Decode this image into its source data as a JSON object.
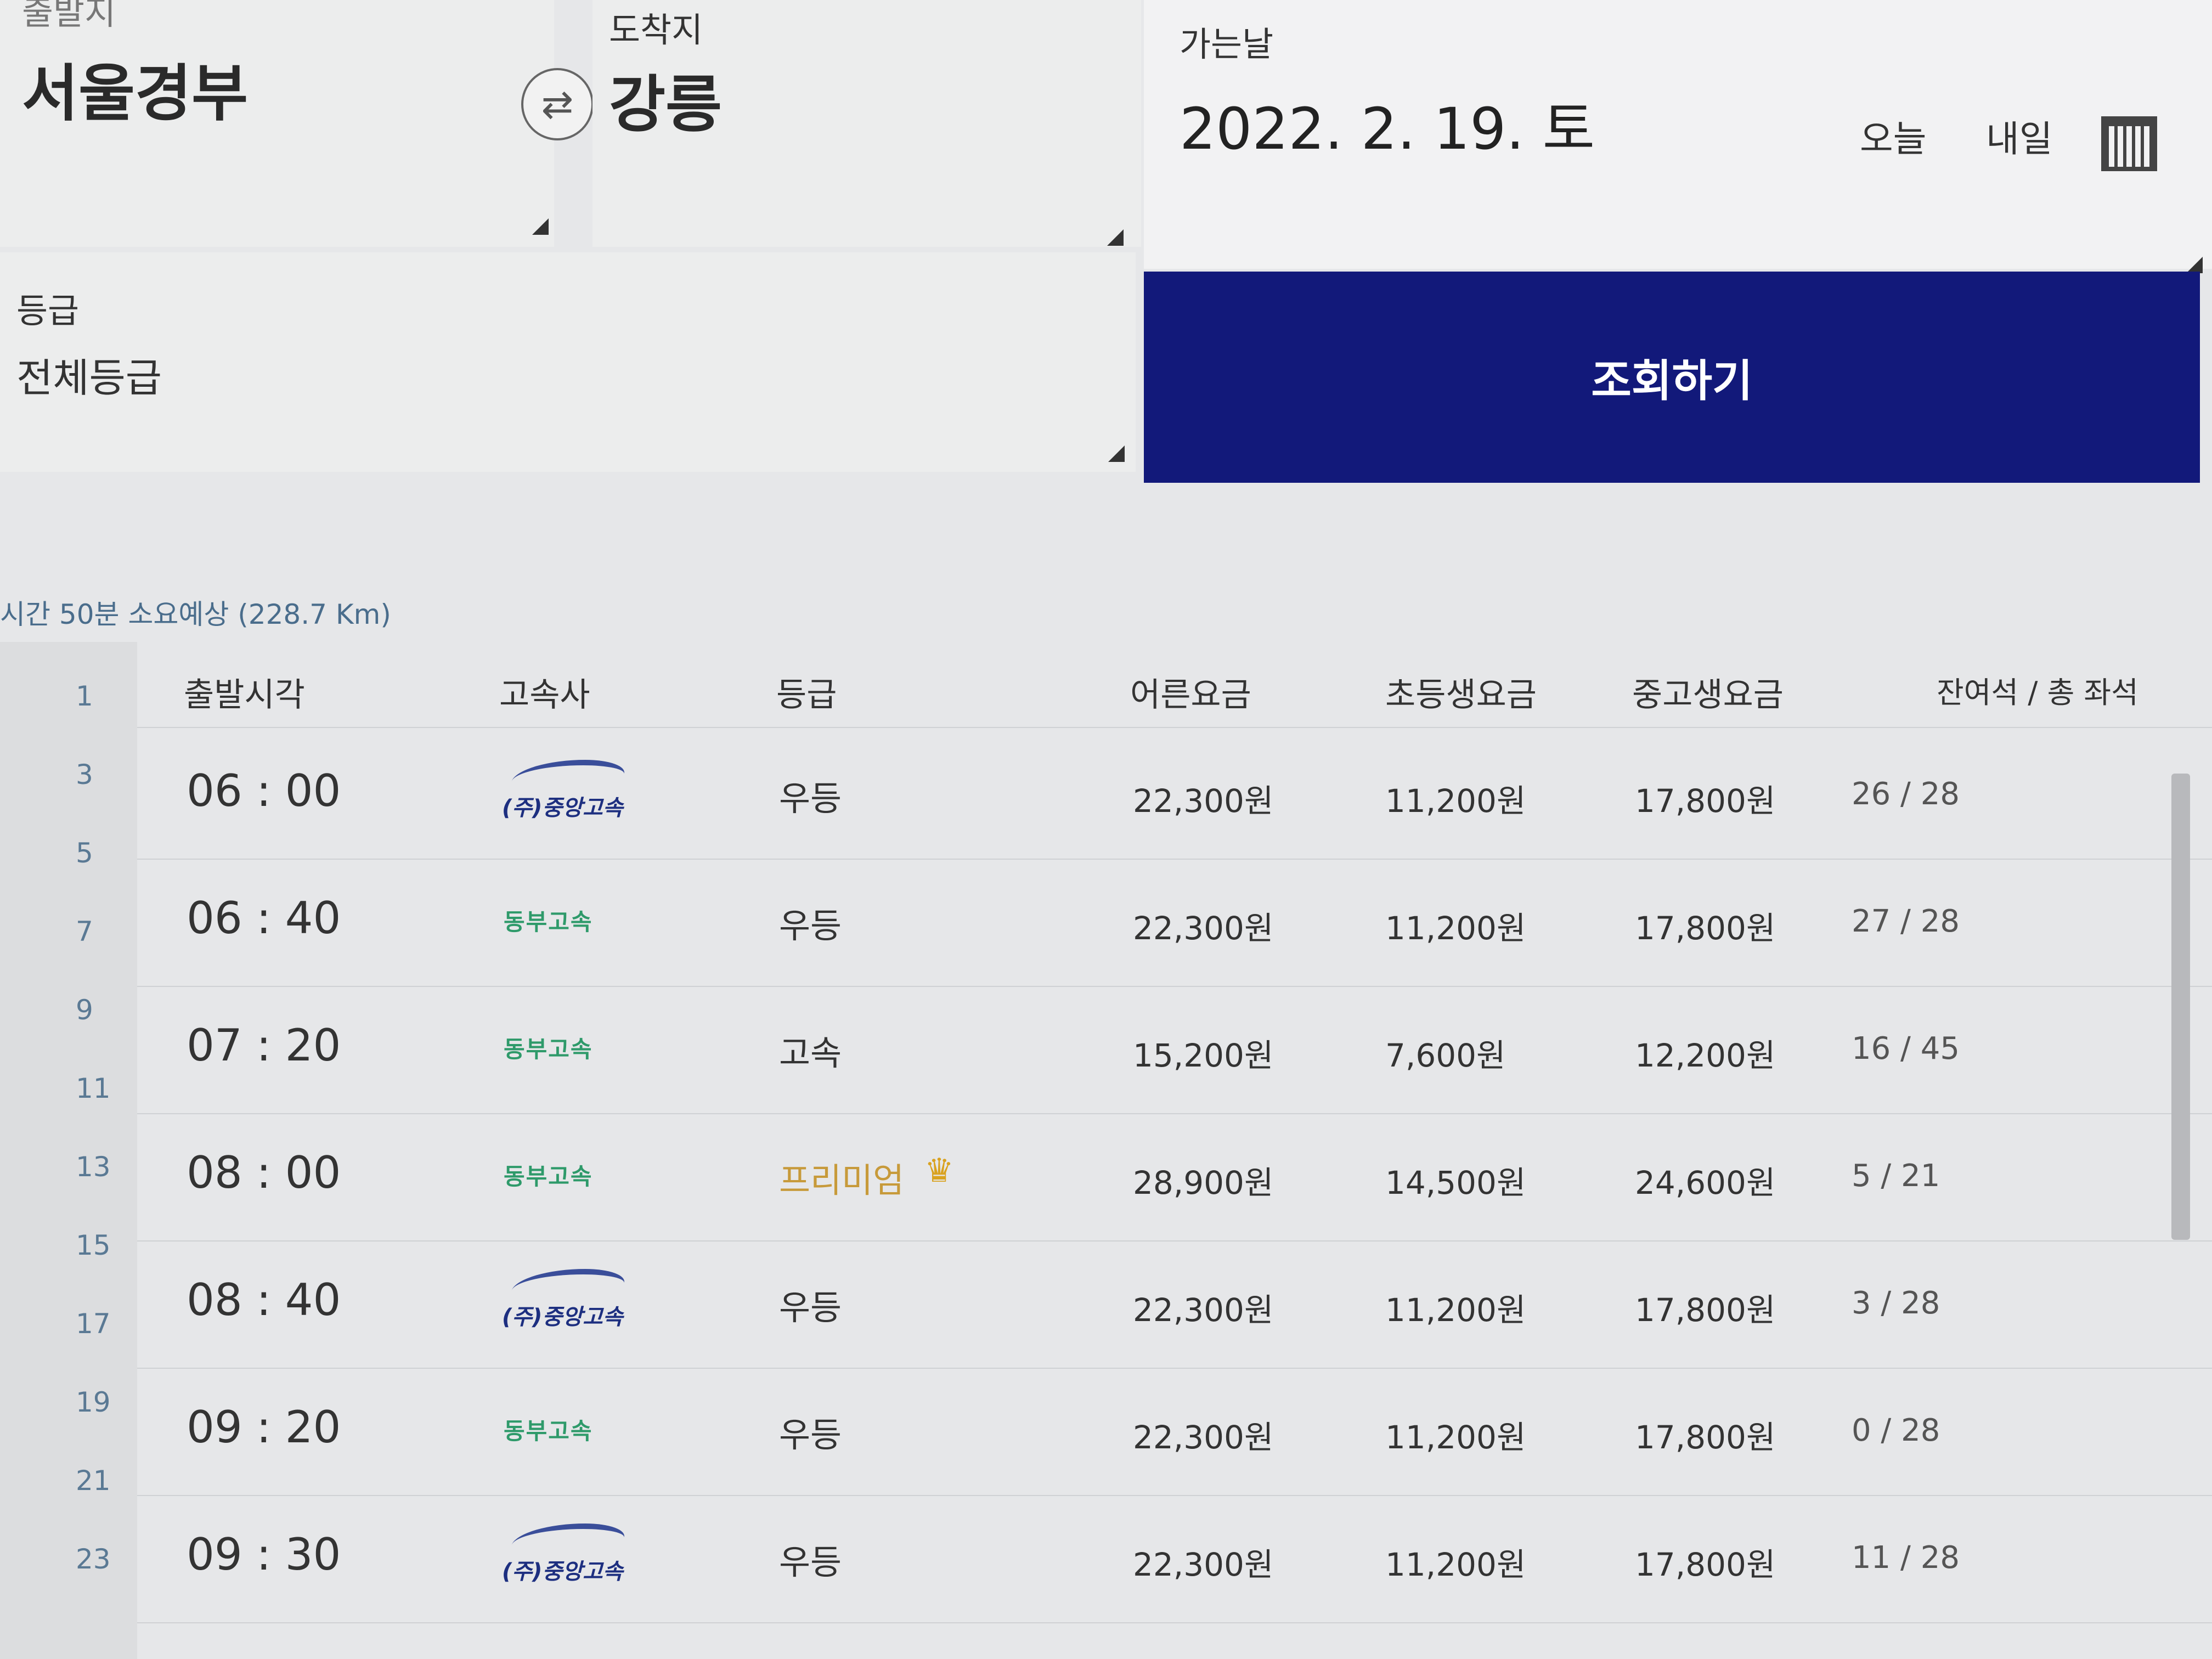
{
  "search": {
    "departure_label": "출발지",
    "departure_value": "서울경부",
    "arrival_label": "도착지",
    "arrival_value": "강릉",
    "date_label": "가는날",
    "date_value": "2022. 2. 19. 토",
    "today_label": "오늘",
    "tomorrow_label": "내일",
    "grade_label": "등급",
    "grade_value": "전체등급",
    "search_button": "조회하기"
  },
  "route_info": "시간 50분 소요예상 (228.7 Km)",
  "line_numbers": [
    "1",
    "3",
    "5",
    "7",
    "9",
    "11",
    "13",
    "15",
    "17",
    "19",
    "21",
    "23"
  ],
  "table": {
    "headers": [
      "출발시각",
      "고속사",
      "등급",
      "어른요금",
      "초등생요금",
      "중고생요금",
      "잔여석 / 총 좌석"
    ],
    "rows": [
      {
        "time": "06 : 00",
        "company": "(주)중앙고속",
        "company_logo": "jungang",
        "grade": "우등",
        "adult": "22,300원",
        "child": "11,200원",
        "student": "17,800원",
        "seats": "26 / 28"
      },
      {
        "time": "06 : 40",
        "company": "동부고속",
        "company_logo": "dongbu",
        "grade": "우등",
        "adult": "22,300원",
        "child": "11,200원",
        "student": "17,800원",
        "seats": "27 / 28"
      },
      {
        "time": "07 : 20",
        "company": "동부고속",
        "company_logo": "dongbu",
        "grade": "고속",
        "adult": "15,200원",
        "child": "7,600원",
        "student": "12,200원",
        "seats": "16 / 45"
      },
      {
        "time": "08 : 00",
        "company": "동부고속",
        "company_logo": "dongbu",
        "grade": "프리미엄",
        "premium": true,
        "adult": "28,900원",
        "child": "14,500원",
        "student": "24,600원",
        "seats": "5 / 21"
      },
      {
        "time": "08 : 40",
        "company": "(주)중앙고속",
        "company_logo": "jungang",
        "grade": "우등",
        "adult": "22,300원",
        "child": "11,200원",
        "student": "17,800원",
        "seats": "3 / 28"
      },
      {
        "time": "09 : 20",
        "company": "동부고속",
        "company_logo": "dongbu",
        "grade": "우등",
        "adult": "22,300원",
        "child": "11,200원",
        "student": "17,800원",
        "seats": "0 / 28"
      },
      {
        "time": "09 : 30",
        "company": "(주)중앙고속",
        "company_logo": "jungang",
        "grade": "우등",
        "adult": "22,300원",
        "child": "11,200원",
        "student": "17,800원",
        "seats": "11 / 28"
      }
    ]
  },
  "colors": {
    "search_button": "#12197a",
    "premium": "#c79a3a",
    "dongbu_logo": "#2e9a6a",
    "jungang_logo": "#1d2f80"
  },
  "icons": [
    "swap-arrows-icon",
    "calendar-icon",
    "crown-icon",
    "dropdown-corner-icon"
  ]
}
